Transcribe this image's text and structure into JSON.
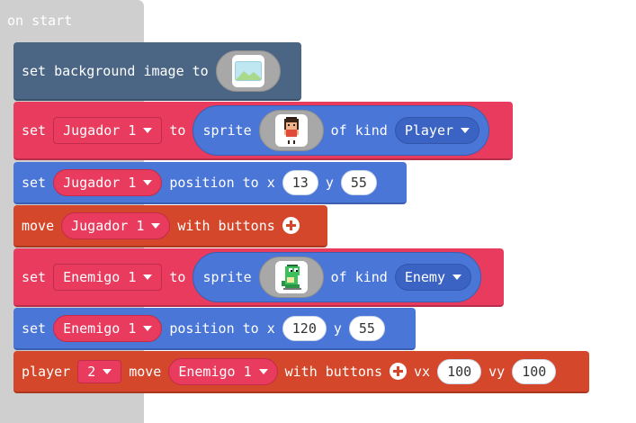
{
  "hat": {
    "label": "on start"
  },
  "blocks": {
    "set_bg": {
      "text": "set background image to",
      "image_icon": "landscape-image-icon"
    },
    "set_player": {
      "set": "set",
      "var": "Jugador 1",
      "to": "to",
      "sprite": "sprite",
      "image_icon": "player-sprite-icon",
      "of_kind": "of kind",
      "kind": "Player"
    },
    "pos_player": {
      "set": "set",
      "var": "Jugador 1",
      "position_to_x": "position to x",
      "x": "13",
      "y_label": "y",
      "y": "55"
    },
    "move_player": {
      "move": "move",
      "var": "Jugador 1",
      "with_buttons": "with buttons",
      "plus_icon": "plus-circle-icon"
    },
    "set_enemy": {
      "set": "set",
      "var": "Enemigo 1",
      "to": "to",
      "sprite": "sprite",
      "image_icon": "enemy-sprite-icon",
      "of_kind": "of kind",
      "kind": "Enemy"
    },
    "pos_enemy": {
      "set": "set",
      "var": "Enemigo 1",
      "position_to_x": "position to x",
      "x": "120",
      "y_label": "y",
      "y": "55"
    },
    "player_move": {
      "player": "player",
      "player_num": "2",
      "move": "move",
      "var": "Enemigo 1",
      "with_buttons": "with buttons",
      "plus_icon": "plus-circle-icon",
      "vx_label": "vx",
      "vx": "100",
      "vy_label": "vy",
      "vy": "100"
    }
  },
  "colors": {
    "hat": "#cfcfcf",
    "scene": "#4b6584",
    "sprites": "#e83b5e",
    "position": "#4a76d8",
    "controller": "#d4472a"
  }
}
